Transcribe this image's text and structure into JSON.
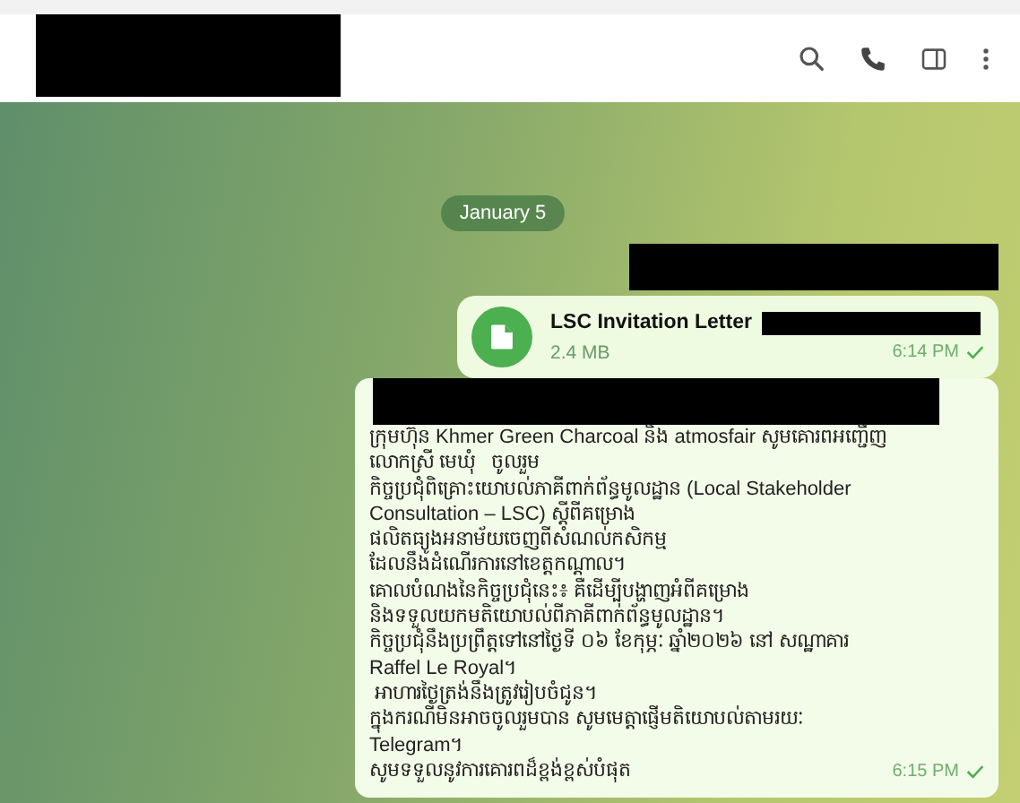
{
  "header": {
    "actions": [
      {
        "kind": "search"
      },
      {
        "kind": "call"
      },
      {
        "kind": "panel"
      },
      {
        "kind": "more"
      }
    ]
  },
  "chat": {
    "date": "January 5",
    "file_message": {
      "name": "LSC Invitation Letter",
      "size": "2.4 MB",
      "time": "6:14 PM",
      "read": false
    },
    "text_message": {
      "lines": [
        "ក្រុមហ៊ុន Khmer Green Charcoal និង atmosfair សូមគោរពអញ្ជើញ",
        "លោកស្រី មេឃុំ   ចូលរួម",
        "កិច្ចប្រជុំពិគ្រោះយោបល់ភាគីពាក់ព័ន្ធមូលដ្ឋាន (Local Stakeholder",
        "Consultation – LSC) ស្ដីពីគម្រោង",
        "ផលិតធ្យូងអនាម័យចេញពីសំណល់កសិកម្ម",
        "ដែលនឹងដំណើរការនៅខេត្តកណ្ដាល។",
        "គោលបំណងនៃកិច្ចប្រជុំនេះ៖ គឺដើម្បីបង្ហាញអំពីគម្រោង",
        "និងទទួលយកមតិយោបល់ពីភាគីពាក់ព័ន្ធមូលដ្ឋាន។",
        "កិច្ចប្រជុំនឹងប្រព្រឹត្តទៅនៅថ្ងៃទី ០៦ ខែកុម្ភៈ ឆ្នាំ២០២៦ នៅ សណ្ឋាគារ",
        "Raffel Le Royal។",
        " អាហារថ្ងៃត្រង់នឹងត្រូវរៀបចំជូន។",
        "ក្នុងករណីមិនអាចចូលរួមបាន សូមមេត្តាផ្ញើមតិយោបល់តាមរយៈ",
        "Telegram។",
        "សូមទទួលនូវការគោរពដ៏ខ្ពង់ខ្ពស់បំផុត"
      ],
      "time": "6:15 PM",
      "read": false
    }
  }
}
